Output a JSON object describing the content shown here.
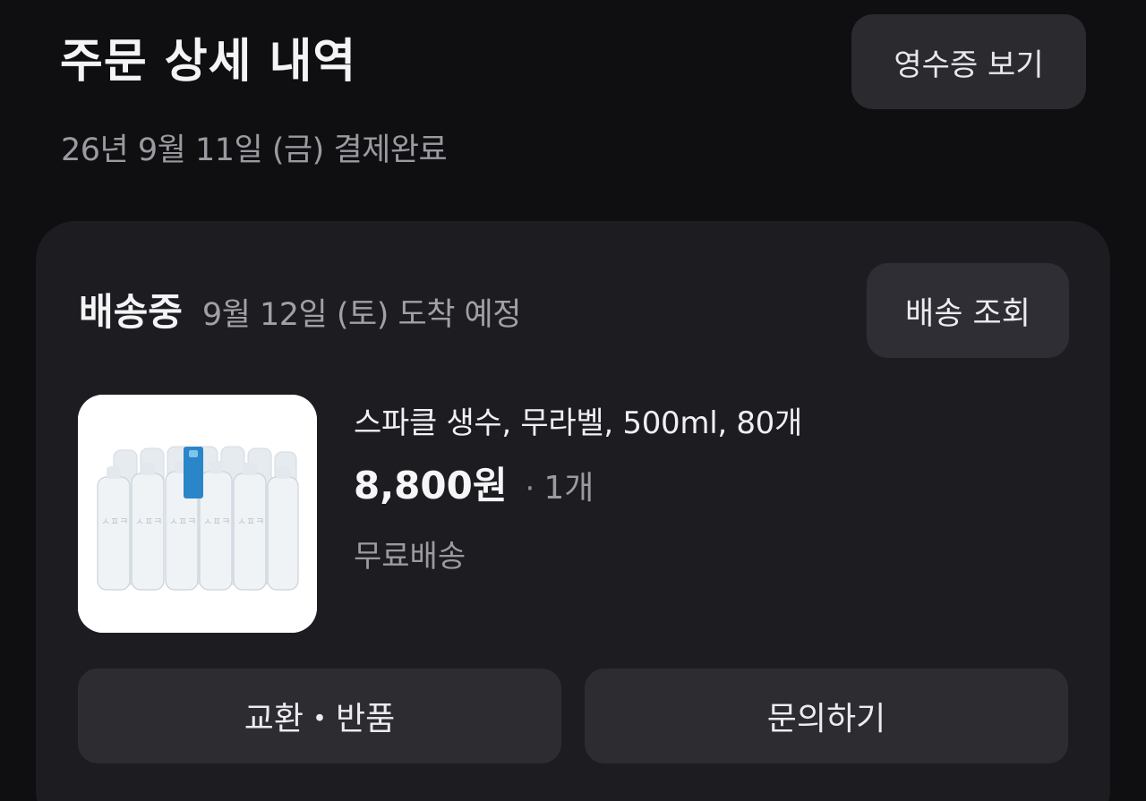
{
  "header": {
    "title": "주문 상세 내역",
    "receipt_button": "영수증 보기",
    "order_meta": "26년 9월 11일 (금) 결제완료"
  },
  "shipment": {
    "status": "배송중",
    "eta": "9월 12일 (토) 도착 예정",
    "track_button": "배송 조회"
  },
  "product": {
    "image_icon": "water-bottles-pack",
    "bottle_label": "스파클",
    "name": "스파클 생수, 무라벨, 500ml, 80개",
    "price": "8,800원",
    "separator": "·",
    "quantity": "1개",
    "shipping": "무료배송"
  },
  "actions": {
    "exchange_return": "교환・반품",
    "inquiry": "문의하기"
  },
  "colors": {
    "background": "#0f0f12",
    "card": "#1c1c21",
    "button": "#2c2c31"
  }
}
